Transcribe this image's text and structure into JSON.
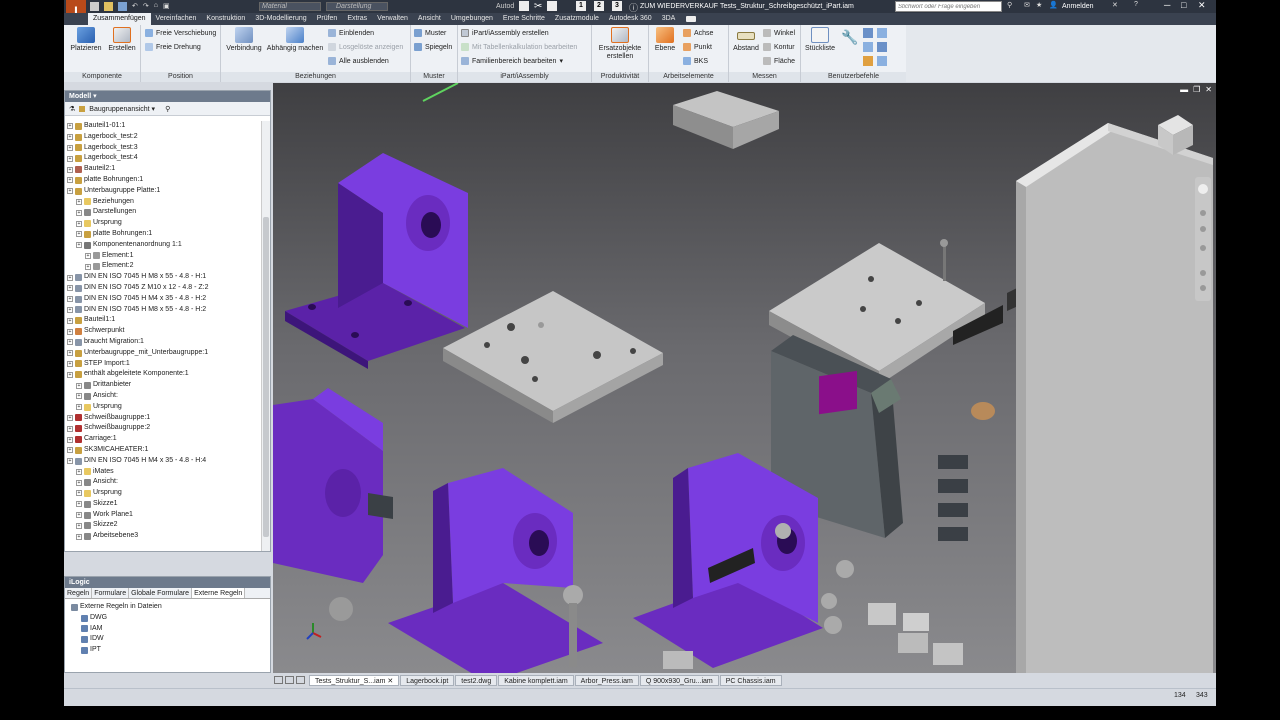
{
  "titlebar": {
    "material": "Material",
    "darstellung": "Darstellung",
    "autodesk": "Autod",
    "btn1": "1",
    "btn2": "2",
    "btn3": "3",
    "resale": "ZUM WIEDERVERKAUF",
    "file_title": "Tests_Struktur_Schreibgeschützt_iPart.iam",
    "search_placeholder": "Stichwort oder Frage eingeben",
    "signin": "Anmelden"
  },
  "tabs": [
    "Zusammenfügen",
    "Vereinfachen",
    "Konstruktion",
    "3D-Modellierung",
    "Prüfen",
    "Extras",
    "Verwalten",
    "Ansicht",
    "Umgebungen",
    "Erste Schritte",
    "Zusatzmodule",
    "Autodesk 360",
    "3DA"
  ],
  "ribbon": {
    "komponente": {
      "label": "Komponente",
      "platzieren": "Platzieren",
      "erstellen": "Erstellen"
    },
    "position": {
      "label": "Position",
      "freie_verschiebung": "Freie Verschiebung",
      "freie_drehung": "Freie Drehung"
    },
    "beziehungen": {
      "label": "Beziehungen",
      "verbindung": "Verbindung",
      "abhaengig": "Abhängig machen",
      "einblenden": "Einblenden",
      "losgeloest": "Losgelöste anzeigen",
      "alle_ausblenden": "Alle ausblenden"
    },
    "muster": {
      "label": "Muster",
      "muster": "Muster",
      "spiegeln": "Spiegeln"
    },
    "ipart": {
      "label": "iPart/iAssembly",
      "erstellen": "iPart/iAssembly erstellen",
      "tabelle": "Mit Tabellenkalkulation bearbeiten",
      "familie": "Familienbereich bearbeiten"
    },
    "produktivitaet": {
      "label": "Produktivität",
      "ersatz": "Ersatzobjekte erstellen"
    },
    "arbeitselemente": {
      "label": "Arbeitselemente",
      "ebene": "Ebene",
      "achse": "Achse",
      "punkt": "Punkt",
      "bks": "BKS"
    },
    "messen": {
      "label": "Messen",
      "abstand": "Abstand",
      "winkel": "Winkel",
      "kontur": "Kontur",
      "flaeche": "Fläche"
    },
    "benutzerbefehle": {
      "label": "Benutzerbefehle",
      "stueckliste": "Stückliste"
    }
  },
  "browser": {
    "title": "Modell",
    "view": "Baugruppenansicht",
    "items": [
      {
        "label": "Bauteil1-01:1",
        "indent": 0,
        "color": "#c8a040"
      },
      {
        "label": "Lagerbock_test:2",
        "indent": 0,
        "color": "#c8a040"
      },
      {
        "label": "Lagerbock_test:3",
        "indent": 0,
        "color": "#c8a040"
      },
      {
        "label": "Lagerbock_test:4",
        "indent": 0,
        "color": "#c8a040"
      },
      {
        "label": "Bauteil2:1",
        "indent": 0,
        "color": "#b06050"
      },
      {
        "label": "platte Bohrungen:1",
        "indent": 0,
        "color": "#c8a040"
      },
      {
        "label": "Unterbaugruppe Platte:1",
        "indent": 0,
        "color": "#c8a040"
      },
      {
        "label": "Beziehungen",
        "indent": 1,
        "color": "#e8c860"
      },
      {
        "label": "Darstellungen",
        "indent": 1,
        "color": "#888"
      },
      {
        "label": "Ursprung",
        "indent": 1,
        "color": "#e8c860"
      },
      {
        "label": "platte Bohrungen:1",
        "indent": 1,
        "color": "#c8a040"
      },
      {
        "label": "Komponentenanordnung 1:1",
        "indent": 1,
        "color": "#777"
      },
      {
        "label": "Element:1",
        "indent": 2,
        "color": "#999"
      },
      {
        "label": "Element:2",
        "indent": 2,
        "color": "#999"
      },
      {
        "label": "DIN EN ISO 7045 H M8 x 55 - 4.8 - H:1",
        "indent": 0,
        "color": "#8895a8"
      },
      {
        "label": "DIN EN ISO 7045 Z M10 x 12 - 4.8 - Z:2",
        "indent": 0,
        "color": "#8895a8"
      },
      {
        "label": "DIN EN ISO 7045 H M4 x 35 - 4.8 - H:2",
        "indent": 0,
        "color": "#8895a8"
      },
      {
        "label": "DIN EN ISO 7045 H M8 x 55 - 4.8 - H:2",
        "indent": 0,
        "color": "#8895a8"
      },
      {
        "label": "Bauteil1:1",
        "indent": 0,
        "color": "#c8a040"
      },
      {
        "label": "Schwerpunkt",
        "indent": 0,
        "color": "#d08040"
      },
      {
        "label": "braucht Migration:1",
        "indent": 0,
        "color": "#8895a8"
      },
      {
        "label": "Unterbaugruppe_mit_Unterbaugruppe:1",
        "indent": 0,
        "color": "#c8a040"
      },
      {
        "label": "STEP Import:1",
        "indent": 0,
        "color": "#c8a040"
      },
      {
        "label": "enthält abgeleitete Komponente:1",
        "indent": 0,
        "color": "#c8a040"
      },
      {
        "label": "Drittanbieter",
        "indent": 1,
        "color": "#888"
      },
      {
        "label": "Ansicht:",
        "indent": 1,
        "color": "#888"
      },
      {
        "label": "Ursprung",
        "indent": 1,
        "color": "#e8c860"
      },
      {
        "label": "Schweißbaugruppe:1",
        "indent": 0,
        "color": "#b03030"
      },
      {
        "label": "Schweißbaugruppe:2",
        "indent": 0,
        "color": "#b03030"
      },
      {
        "label": "Carriage:1",
        "indent": 0,
        "color": "#b03030"
      },
      {
        "label": "SK3MICAHEATER:1",
        "indent": 0,
        "color": "#c8a040"
      },
      {
        "label": "DIN EN ISO 7045 H M4 x 35 - 4.8 - H:4",
        "indent": 0,
        "color": "#8895a8"
      },
      {
        "label": "iMates",
        "indent": 1,
        "color": "#e8c860"
      },
      {
        "label": "Ansicht:",
        "indent": 1,
        "color": "#888"
      },
      {
        "label": "Ursprung",
        "indent": 1,
        "color": "#e8c860"
      },
      {
        "label": "Skizze1",
        "indent": 1,
        "color": "#888"
      },
      {
        "label": "Work Plane1",
        "indent": 1,
        "color": "#888"
      },
      {
        "label": "Skizze2",
        "indent": 1,
        "color": "#888"
      },
      {
        "label": "Arbeitsebene3",
        "indent": 1,
        "color": "#888"
      }
    ]
  },
  "ilogic": {
    "title": "iLogic",
    "tabs": [
      "Regeln",
      "Formulare",
      "Globale Formulare",
      "Externe Regeln"
    ],
    "root": "Externe Regeln in Dateien",
    "items": [
      "DWG",
      "IAM",
      "IDW",
      "IPT"
    ]
  },
  "doctabs": [
    "Tests_Struktur_S...iam",
    "Lagerbock.ipt",
    "test2.dwg",
    "Kabine komplett.iam",
    "Arbor_Press.iam",
    "Q 900x930_Gru...iam",
    "PC Chassis.iam"
  ],
  "status": {
    "left": "134",
    "right": "343"
  },
  "colors": {
    "purple": "#6a2cc0",
    "gray": "#bdbdbd",
    "ribbon": "#eef1f5"
  }
}
